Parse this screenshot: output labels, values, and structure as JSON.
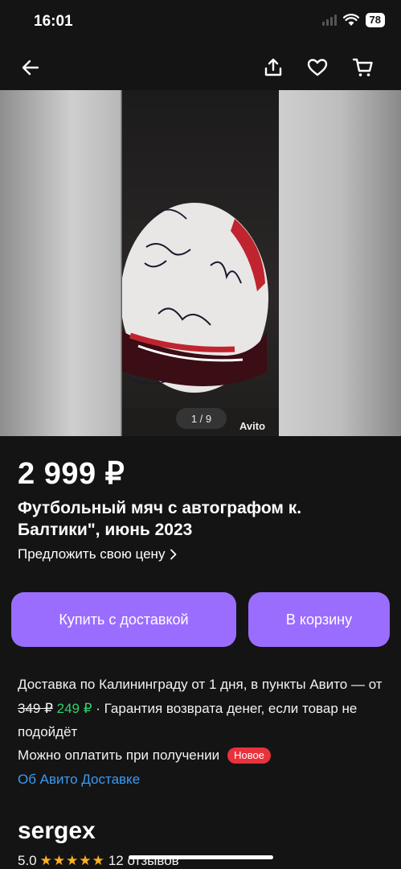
{
  "status_bar": {
    "time": "16:01",
    "battery": "78"
  },
  "gallery": {
    "counter": "1 / 9",
    "watermark": "Avito"
  },
  "listing": {
    "price": "2 999 ₽",
    "title": "Футбольный мяч с автографом к. Балтики\", июнь 2023",
    "offer_price_link": "Предложить свою цену"
  },
  "actions": {
    "buy_with_delivery": "Купить с доставкой",
    "add_to_cart": "В корзину"
  },
  "delivery": {
    "text_start": "Доставка по Калининграду от 1 дня, в пункты Авито — от ",
    "old_price": "349 ₽",
    "new_price": "249 ₽",
    "text_end": " · Гарантия возврата денег, если товар не подойдёт",
    "pay_on_receipt": "Можно оплатить при получении",
    "badge_new": "Новое",
    "about_link": "Об Авито Доставке"
  },
  "seller": {
    "name": "sergex",
    "rating": "5.0",
    "stars": "★★★★★",
    "reviews": "12 отзывов"
  },
  "icons": [
    "back-arrow-icon",
    "share-icon",
    "heart-icon",
    "cart-icon",
    "chevron-right-icon",
    "wifi-icon",
    "signal-icon"
  ],
  "colors": {
    "accent": "#9b6dff",
    "link": "#3a9bf5",
    "new_price": "#2fd06b",
    "badge": "#e8323c",
    "stars": "#ffb020"
  }
}
